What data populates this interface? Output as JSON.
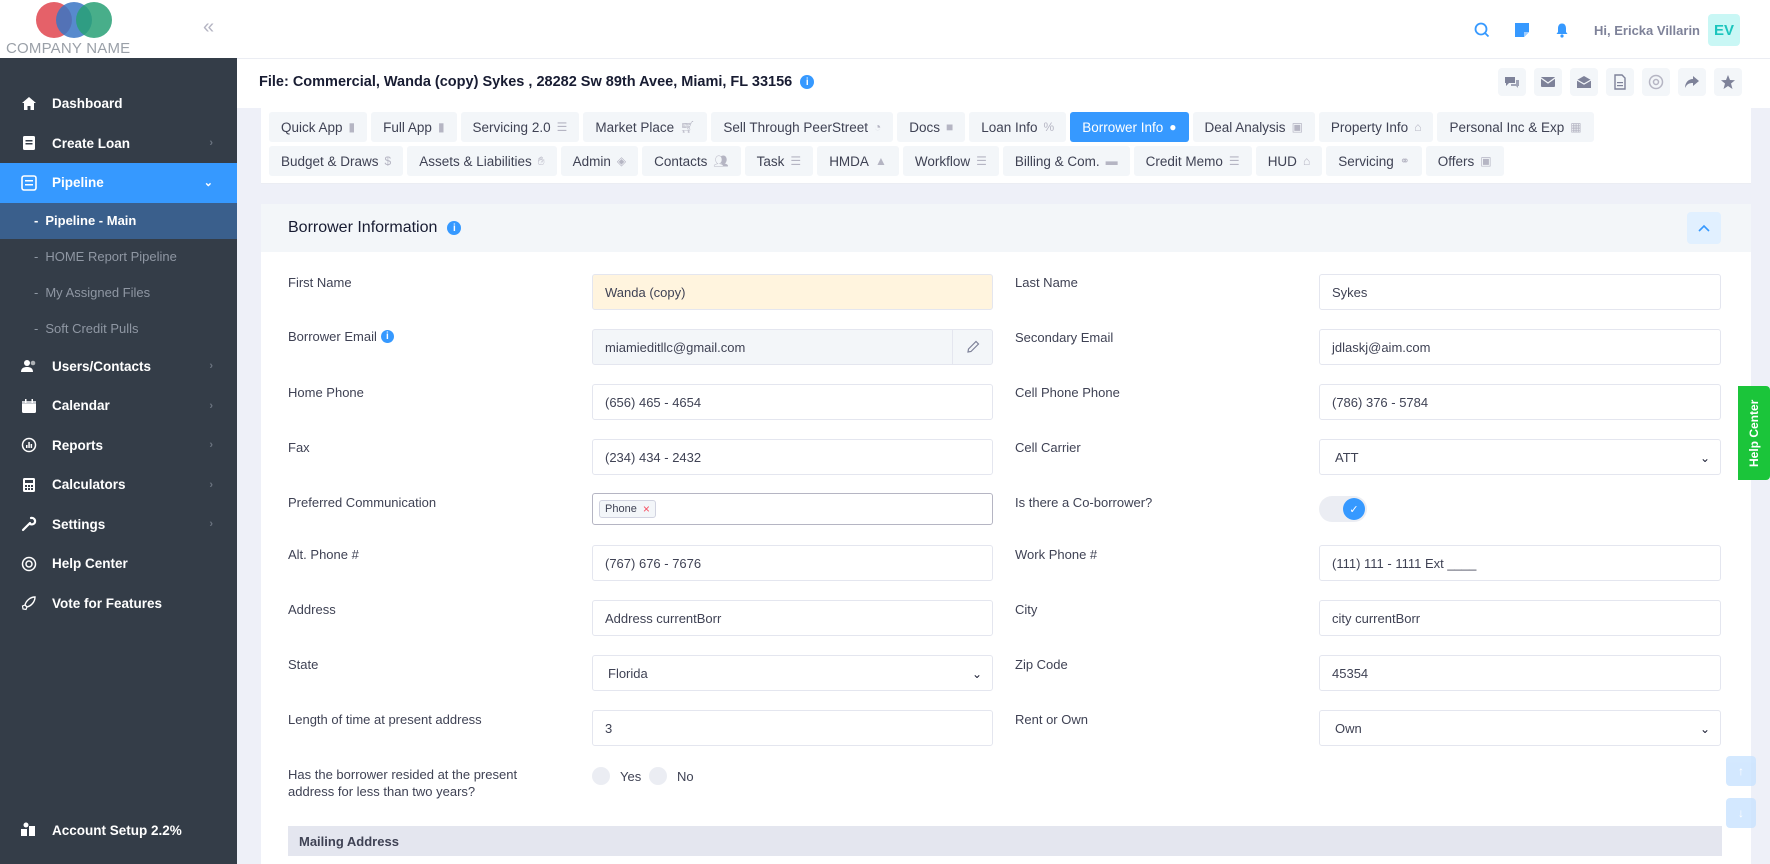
{
  "brand": {
    "company_name": "COMPANY NAME"
  },
  "sidebar": {
    "items": [
      {
        "label": "Dashboard",
        "icon": "home-icon"
      },
      {
        "label": "Create Loan",
        "icon": "document-icon"
      },
      {
        "label": "Pipeline",
        "icon": "list-icon"
      },
      {
        "label": "Users/Contacts",
        "icon": "users-icon"
      },
      {
        "label": "Calendar",
        "icon": "calendar-icon"
      },
      {
        "label": "Reports",
        "icon": "reports-icon"
      },
      {
        "label": "Calculators",
        "icon": "calculator-icon"
      },
      {
        "label": "Settings",
        "icon": "wrench-icon"
      },
      {
        "label": "Help Center",
        "icon": "help-icon"
      },
      {
        "label": "Vote for Features",
        "icon": "rocket-icon"
      }
    ],
    "subitems": [
      {
        "label": "Pipeline - Main"
      },
      {
        "label": "HOME Report Pipeline"
      },
      {
        "label": "My Assigned Files"
      },
      {
        "label": "Soft Credit Pulls"
      }
    ],
    "account_setup": "Account Setup 2.2%"
  },
  "topbar": {
    "greeting": "Hi, Ericka Villarin",
    "avatar_initials": "EV"
  },
  "file_title": "File: Commercial, Wanda (copy) Sykes , 28282 Sw 89th Avee, Miami, FL 33156",
  "tabs_row1": [
    "Quick App",
    "Full App",
    "Servicing 2.0",
    "Market Place",
    "Sell Through PeerStreet",
    "Docs",
    "Loan Info",
    "Borrower Info",
    "Deal Analysis",
    "Property Info",
    "Personal Inc & Exp"
  ],
  "tabs_row2": [
    "Budget & Draws",
    "Assets & Liabilities",
    "Admin",
    "Contacts",
    "Task",
    "HMDA",
    "Workflow",
    "Billing & Com.",
    "Credit Memo",
    "HUD",
    "Servicing",
    "Offers"
  ],
  "section_title": "Borrower Information",
  "fields": {
    "first_name": {
      "label": "First Name",
      "value": "Wanda (copy)"
    },
    "last_name": {
      "label": "Last Name",
      "value": "Sykes"
    },
    "borrower_email": {
      "label": "Borrower Email",
      "value": "miamieditllc@gmail.com"
    },
    "secondary_email": {
      "label": "Secondary Email",
      "value": "jdlaskj@aim.com"
    },
    "home_phone": {
      "label": "Home Phone",
      "value": "(656) 465 - 4654"
    },
    "cell_phone": {
      "label": "Cell Phone Phone",
      "value": "(786) 376 - 5784"
    },
    "fax": {
      "label": "Fax",
      "value": "(234) 434 - 2432"
    },
    "cell_carrier": {
      "label": "Cell Carrier",
      "value": "ATT"
    },
    "preferred_comm": {
      "label": "Preferred Communication",
      "value": "Phone"
    },
    "co_borrower": {
      "label": "Is there a Co-borrower?",
      "checked": true
    },
    "alt_phone": {
      "label": "Alt. Phone #",
      "value": "(767) 676 - 7676"
    },
    "work_phone": {
      "label": "Work Phone #",
      "value": "(111) 111 - 1111 Ext ____"
    },
    "address": {
      "label": "Address",
      "value": "Address currentBorr"
    },
    "city": {
      "label": "City",
      "value": "city currentBorr"
    },
    "state": {
      "label": "State",
      "value": "Florida"
    },
    "zip": {
      "label": "Zip Code",
      "value": "45354"
    },
    "length_time": {
      "label": "Length of time at present address",
      "value": "3"
    },
    "rent_own": {
      "label": "Rent or Own",
      "value": "Own"
    },
    "resided_less": {
      "label_line1": "Has the borrower resided at the present",
      "label_line2": "address for less than two years?",
      "yes": "Yes",
      "no": "No"
    }
  },
  "mailing_address": "Mailing Address",
  "help_center_tab": "Help Center",
  "colors": {
    "primary": "#3699ff",
    "sidebar": "#343d48",
    "help": "#1bc53a"
  }
}
